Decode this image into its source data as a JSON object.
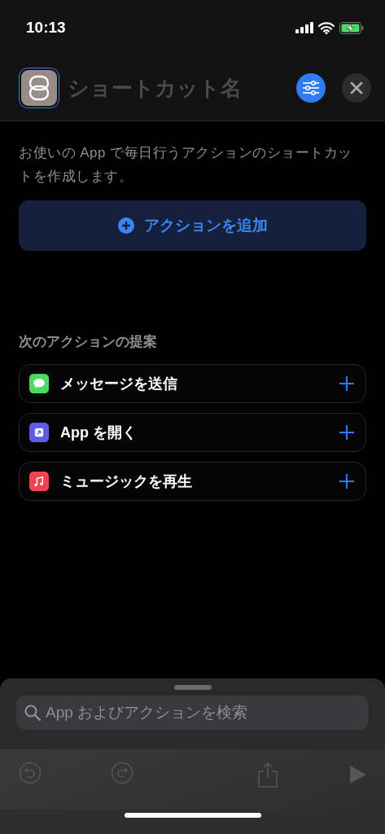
{
  "status_bar": {
    "time": "10:13"
  },
  "header": {
    "name_placeholder": "ショートカット名"
  },
  "description": "お使いの App で毎日行うアクションのショートカットを作成します。",
  "add_action_button": "アクションを追加",
  "suggestions": {
    "title": "次のアクションの提案",
    "items": [
      {
        "label": "メッセージを送信",
        "kind": "messages",
        "color": "#4cd964"
      },
      {
        "label": "App を開く",
        "kind": "open-app",
        "color": "#5e5ce6"
      },
      {
        "label": "ミュージックを再生",
        "kind": "music",
        "color": "#f0424f"
      }
    ]
  },
  "search": {
    "placeholder": "App およびアクションを検索"
  }
}
